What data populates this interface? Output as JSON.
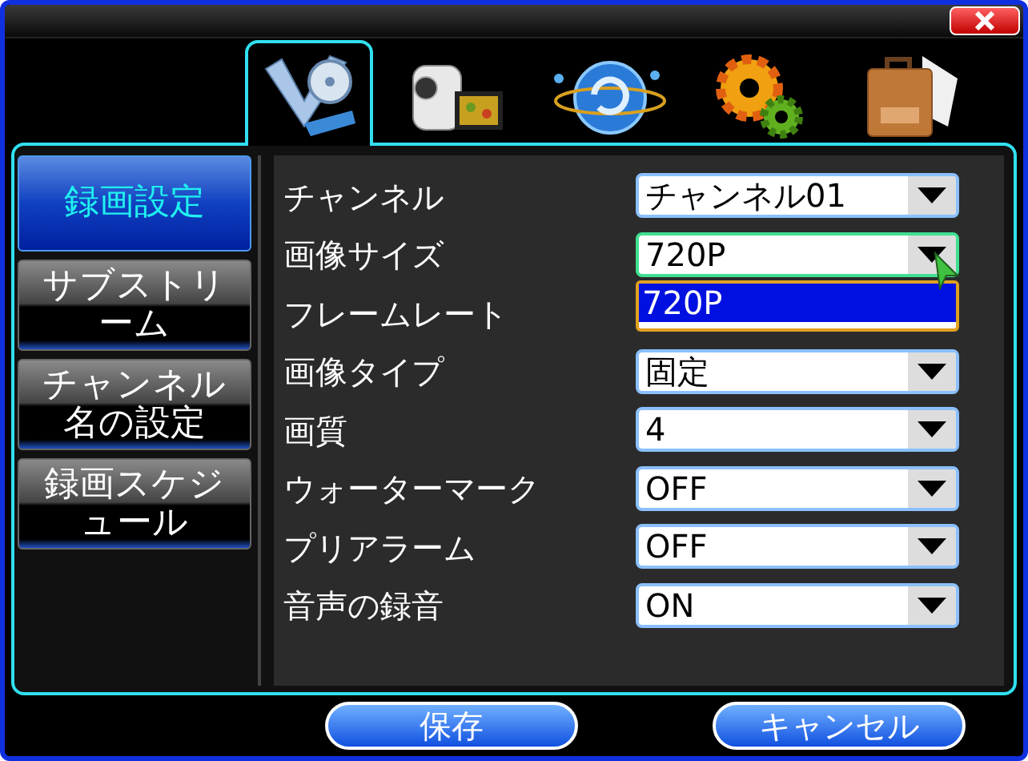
{
  "tabs": [
    {
      "kind": "film",
      "selected": true
    },
    {
      "kind": "camcorder",
      "selected": false
    },
    {
      "kind": "globe",
      "selected": false
    },
    {
      "kind": "gears",
      "selected": false
    },
    {
      "kind": "briefcase",
      "selected": false
    }
  ],
  "sidebar": {
    "items": [
      {
        "label": "録画設定",
        "selected": true
      },
      {
        "label": "サブストリーム",
        "selected": false
      },
      {
        "label": "チャンネル名の設定",
        "selected": false
      },
      {
        "label": "録画スケジュール",
        "selected": false
      }
    ]
  },
  "settings": [
    {
      "label": "チャンネル",
      "value": "チャンネル01",
      "focused": false
    },
    {
      "label": "画像サイズ",
      "value": "720P",
      "focused": true,
      "open": true
    },
    {
      "label": "フレームレート"
    },
    {
      "label": "画像タイプ",
      "value": "固定",
      "focused": false
    },
    {
      "label": "画質",
      "value": "4",
      "focused": false
    },
    {
      "label": "ウォーターマーク",
      "value": "OFF",
      "focused": false
    },
    {
      "label": "プリアラーム",
      "value": "OFF",
      "focused": false
    },
    {
      "label": "音声の録音",
      "value": "ON",
      "focused": false
    }
  ],
  "dropdown_list": {
    "options": [
      {
        "label": "720P",
        "selected": true
      }
    ]
  },
  "buttons": [
    {
      "label": "保存"
    },
    {
      "label": "キャンセル"
    }
  ]
}
